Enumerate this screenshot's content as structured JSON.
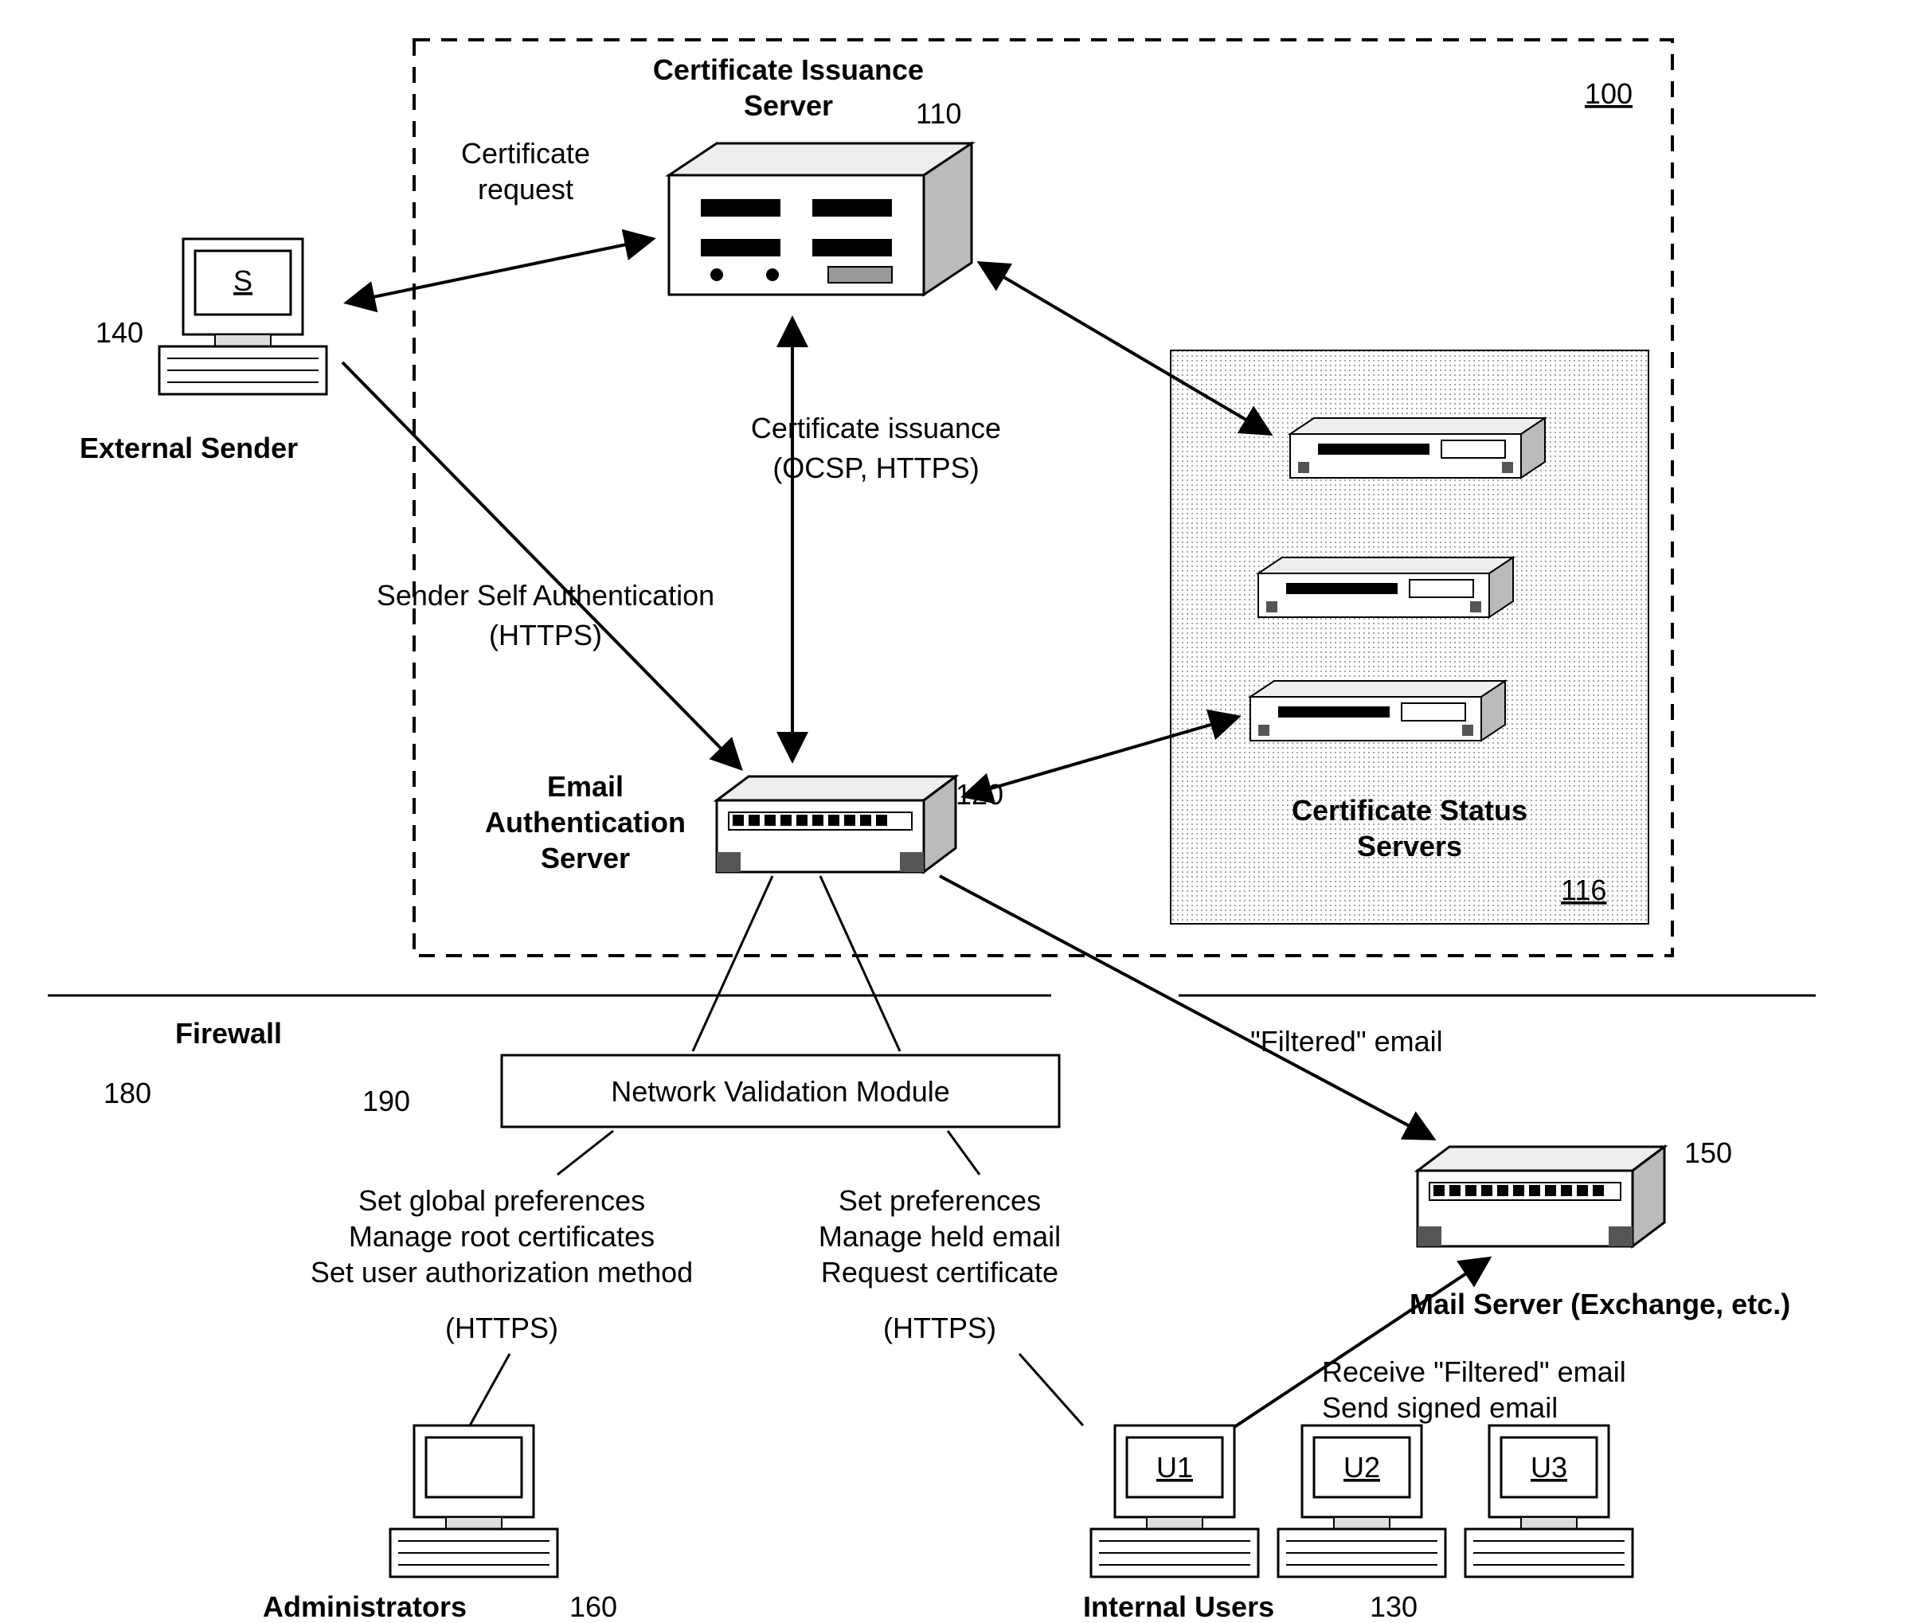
{
  "title": {
    "cis": "Certificate Issuance",
    "cis2": "Server",
    "cis_num": "110",
    "box_num": "100",
    "css": "Certificate Status",
    "css2": "Servers",
    "css_num": "116",
    "eas": "Email",
    "eas2": "Authentication",
    "eas3": "Server",
    "eas_num": "120",
    "ext": "External Sender",
    "ext_num": "140",
    "firewall": "Firewall",
    "firewall_num": "180",
    "nvm": "Network Validation Module",
    "nvm_num": "190",
    "mail1": "Mail Server (Exchange, etc.)",
    "mail_num": "150",
    "admins": "Administrators",
    "admins_num": "160",
    "users": "Internal Users",
    "users_num": "130"
  },
  "labels": {
    "cert_req1": "Certificate",
    "cert_req2": "request",
    "cert_iss1": "Certificate issuance",
    "cert_iss2": "(OCSP, HTTPS)",
    "ssa1": "Sender Self Authentication",
    "ssa2": "(HTTPS)",
    "filtered": "\"Filtered\" email",
    "admin1": "Set global preferences",
    "admin2": "Manage root certificates",
    "admin3": "Set user authorization method",
    "admin4": "(HTTPS)",
    "user1": "Set preferences",
    "user2": "Manage held email",
    "user3": "Request certificate",
    "user4": "(HTTPS)",
    "recv1": "Receive \"Filtered\" email",
    "recv2": "Send signed email",
    "s": "S",
    "u1": "U1",
    "u2": "U2",
    "u3": "U3"
  }
}
